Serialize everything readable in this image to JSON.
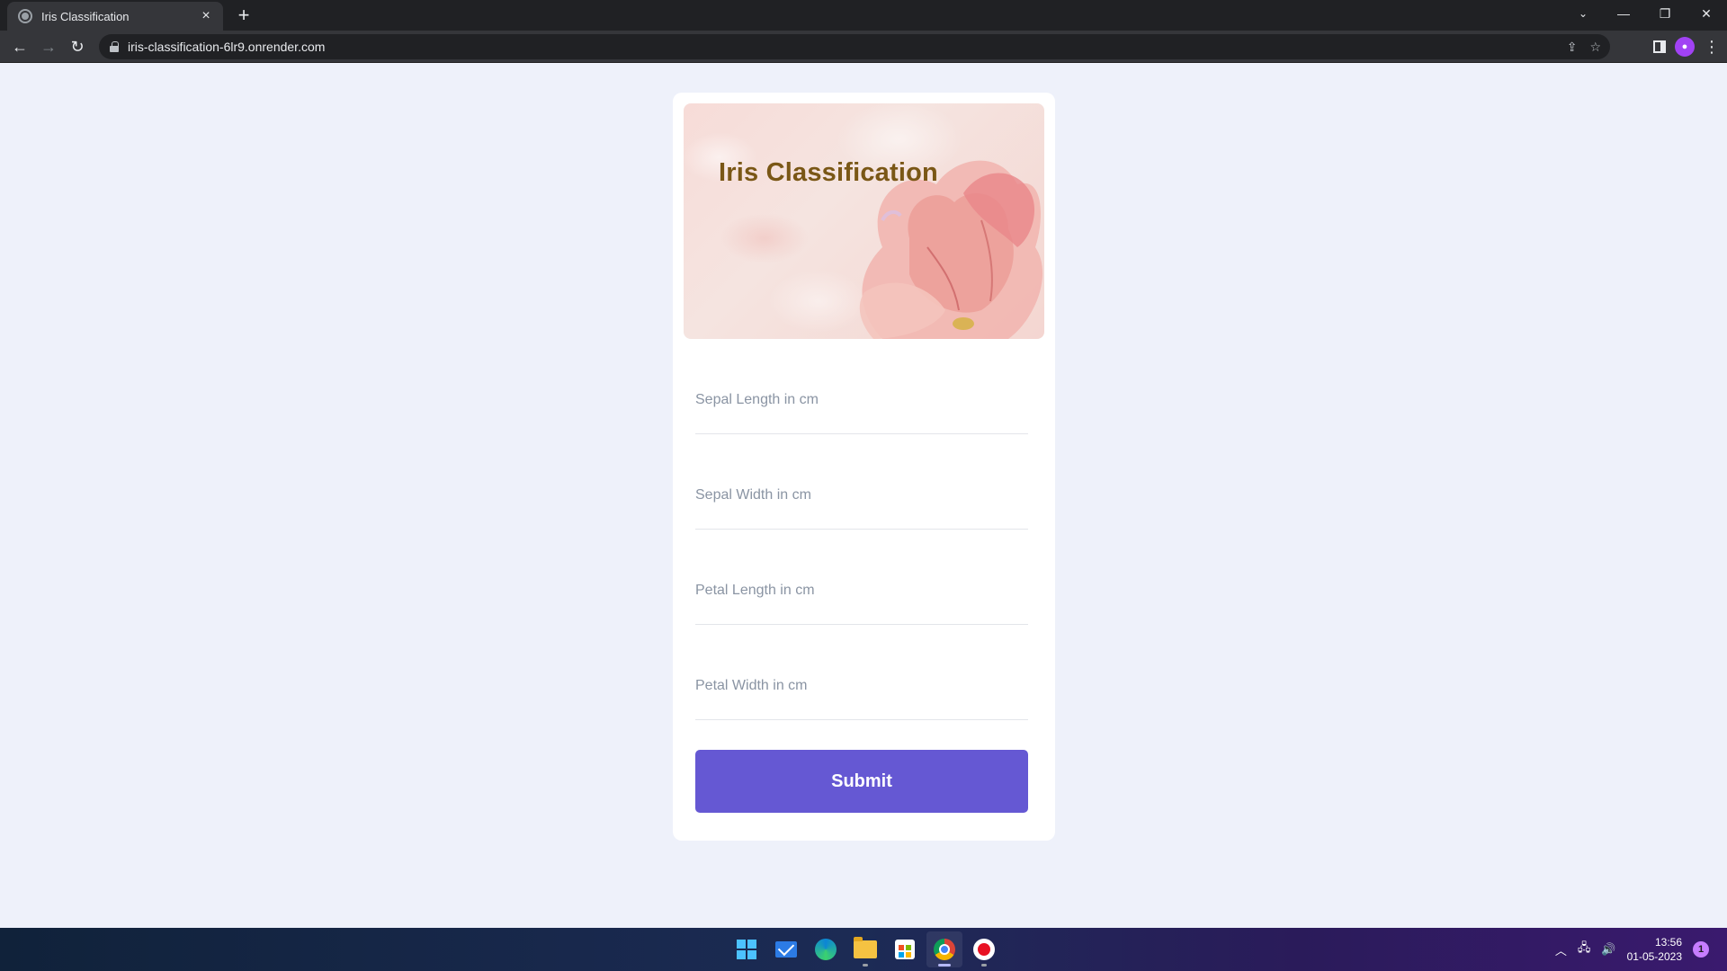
{
  "browser": {
    "tab_title": "Iris Classification",
    "new_tab_glyph": "+",
    "url": "iris-classification-6lr9.onrender.com"
  },
  "page": {
    "banner_title": "Iris Classification",
    "fields": [
      {
        "placeholder": "Sepal Length in cm",
        "value": ""
      },
      {
        "placeholder": "Sepal Width in cm",
        "value": ""
      },
      {
        "placeholder": "Petal Length in cm",
        "value": ""
      },
      {
        "placeholder": "Petal Width in cm",
        "value": ""
      }
    ],
    "submit_label": "Submit"
  },
  "taskbar": {
    "time": "13:56",
    "date": "01-05-2023",
    "notification_count": "1"
  },
  "colors": {
    "accent": "#6558d3",
    "title": "#7a5716",
    "page_background": "#eef1fa"
  },
  "icons": [
    "back-arrow-icon",
    "forward-arrow-icon",
    "reload-icon",
    "lock-icon",
    "share-icon",
    "star-icon",
    "side-panel-icon",
    "profile-icon",
    "menu-icon",
    "windows-start-icon",
    "mail-icon",
    "edge-icon",
    "file-explorer-icon",
    "store-icon",
    "chrome-icon",
    "record-icon"
  ]
}
